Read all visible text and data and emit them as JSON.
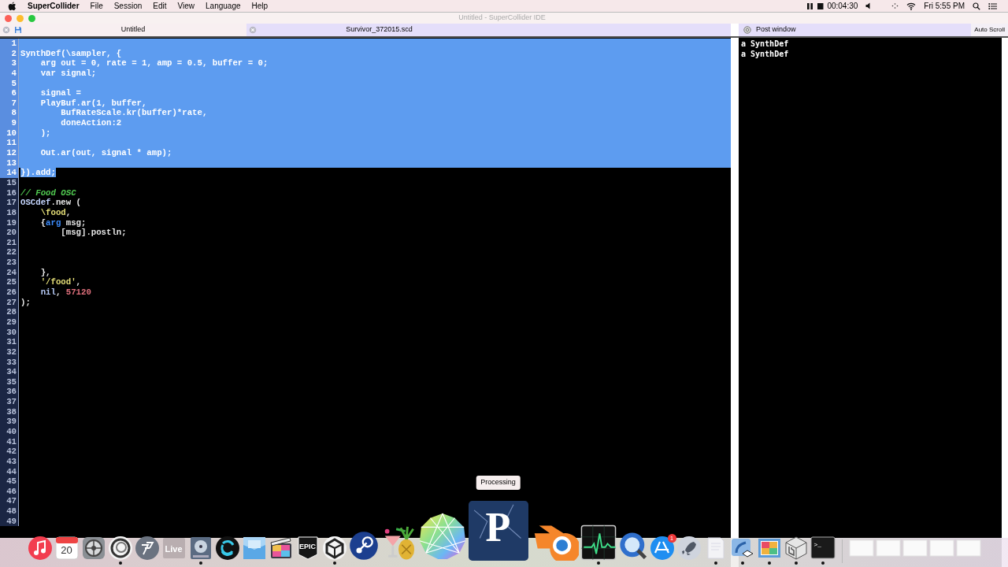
{
  "menu_bar": {
    "app": "SuperCollider",
    "menus": [
      "File",
      "Session",
      "Edit",
      "View",
      "Language",
      "Help"
    ],
    "timer": "00:04:30",
    "clock": "Fri 5:55 PM"
  },
  "window": {
    "title": "Untitled - SuperCollider IDE"
  },
  "tabs": [
    {
      "label": "Untitled",
      "selected": true,
      "unsaved": true
    },
    {
      "label": "Survivor_372015.scd",
      "selected": false,
      "unsaved": false
    }
  ],
  "editor": {
    "lines": [
      {
        "n": "1",
        "selected": true
      },
      {
        "n": "2",
        "selected": true,
        "tokens": [
          {
            "kind": "class",
            "text": "SynthDef"
          },
          {
            "kind": "plain",
            "text": "("
          },
          {
            "kind": "symbol",
            "text": "\\sampler"
          },
          {
            "kind": "plain",
            "text": ", {"
          }
        ]
      },
      {
        "n": "3",
        "selected": true,
        "tokens": [
          {
            "kind": "keyword",
            "text": "    arg"
          },
          {
            "kind": "plain",
            "text": " out = "
          },
          {
            "kind": "number",
            "text": "0"
          },
          {
            "kind": "plain",
            "text": ", rate = "
          },
          {
            "kind": "number",
            "text": "1"
          },
          {
            "kind": "plain",
            "text": ", amp = "
          },
          {
            "kind": "number",
            "text": "0.5"
          },
          {
            "kind": "plain",
            "text": ", buffer = "
          },
          {
            "kind": "number",
            "text": "0"
          },
          {
            "kind": "plain",
            "text": ";"
          }
        ]
      },
      {
        "n": "4",
        "selected": true,
        "tokens": [
          {
            "kind": "keyword",
            "text": "    var"
          },
          {
            "kind": "plain",
            "text": " signal;"
          }
        ]
      },
      {
        "n": "5",
        "selected": true
      },
      {
        "n": "6",
        "selected": true,
        "tokens": [
          {
            "kind": "plain",
            "text": "    signal ="
          }
        ]
      },
      {
        "n": "7",
        "selected": true,
        "tokens": [
          {
            "kind": "class",
            "text": "    PlayBuf"
          },
          {
            "kind": "plain",
            "text": ".ar("
          },
          {
            "kind": "number",
            "text": "1"
          },
          {
            "kind": "plain",
            "text": ", buffer,"
          }
        ]
      },
      {
        "n": "8",
        "selected": true,
        "tokens": [
          {
            "kind": "class",
            "text": "        BufRateScale"
          },
          {
            "kind": "plain",
            "text": ".kr(buffer)*rate,"
          }
        ]
      },
      {
        "n": "9",
        "selected": true,
        "tokens": [
          {
            "kind": "plain",
            "text": "        doneAction:"
          },
          {
            "kind": "number",
            "text": "2"
          }
        ]
      },
      {
        "n": "10",
        "selected": true,
        "tokens": [
          {
            "kind": "plain",
            "text": "    );"
          }
        ]
      },
      {
        "n": "11",
        "selected": true
      },
      {
        "n": "12",
        "selected": true,
        "tokens": [
          {
            "kind": "class",
            "text": "    Out"
          },
          {
            "kind": "plain",
            "text": ".ar(out, signal * amp);"
          }
        ]
      },
      {
        "n": "13",
        "selected": true
      },
      {
        "n": "14",
        "selected": true,
        "tokens": [
          {
            "kind": "plain",
            "text": "}).add;"
          }
        ]
      },
      {
        "n": "15",
        "selected": false
      },
      {
        "n": "16",
        "selected": false,
        "tokens": [
          {
            "kind": "comment",
            "text": "// Food OSC"
          }
        ]
      },
      {
        "n": "17",
        "selected": false,
        "tokens": [
          {
            "kind": "class",
            "text": "OSCdef"
          },
          {
            "kind": "plain",
            "text": ".new ("
          }
        ]
      },
      {
        "n": "18",
        "selected": false,
        "tokens": [
          {
            "kind": "symbol",
            "text": "    \\food"
          },
          {
            "kind": "plain",
            "text": ","
          }
        ]
      },
      {
        "n": "19",
        "selected": false,
        "tokens": [
          {
            "kind": "plain",
            "text": "    {"
          },
          {
            "kind": "keyword",
            "text": "arg"
          },
          {
            "kind": "plain",
            "text": " msg;"
          }
        ]
      },
      {
        "n": "20",
        "selected": false,
        "tokens": [
          {
            "kind": "plain",
            "text": "        [msg].postln;"
          }
        ]
      },
      {
        "n": "21",
        "selected": false
      },
      {
        "n": "22",
        "selected": false
      },
      {
        "n": "23",
        "selected": false
      },
      {
        "n": "24",
        "selected": false,
        "tokens": [
          {
            "kind": "plain",
            "text": "    },"
          }
        ]
      },
      {
        "n": "25",
        "selected": false,
        "tokens": [
          {
            "kind": "string",
            "text": "    '/food'"
          },
          {
            "kind": "plain",
            "text": ","
          }
        ]
      },
      {
        "n": "26",
        "selected": false,
        "tokens": [
          {
            "kind": "constant",
            "text": "    nil"
          },
          {
            "kind": "plain",
            "text": ", "
          },
          {
            "kind": "number",
            "text": "57120"
          }
        ]
      },
      {
        "n": "27",
        "selected": false,
        "tokens": [
          {
            "kind": "plain",
            "text": ");"
          }
        ]
      },
      {
        "n": "28",
        "selected": false
      },
      {
        "n": "29",
        "selected": false
      },
      {
        "n": "30",
        "selected": false
      },
      {
        "n": "31",
        "selected": false
      },
      {
        "n": "32",
        "selected": false
      },
      {
        "n": "33",
        "selected": false
      },
      {
        "n": "34",
        "selected": false
      },
      {
        "n": "35",
        "selected": false
      },
      {
        "n": "36",
        "selected": false
      },
      {
        "n": "37",
        "selected": false
      },
      {
        "n": "38",
        "selected": false
      },
      {
        "n": "39",
        "selected": false
      },
      {
        "n": "40",
        "selected": false
      },
      {
        "n": "41",
        "selected": false
      },
      {
        "n": "42",
        "selected": false
      },
      {
        "n": "43",
        "selected": false
      },
      {
        "n": "44",
        "selected": false
      },
      {
        "n": "45",
        "selected": false
      },
      {
        "n": "46",
        "selected": false
      },
      {
        "n": "47",
        "selected": false
      },
      {
        "n": "48",
        "selected": false
      },
      {
        "n": "49",
        "selected": false
      }
    ]
  },
  "post_window": {
    "title": "Post window",
    "auto_scroll": "Auto Scroll",
    "lines": [
      "a SynthDef",
      "a SynthDef"
    ]
  },
  "dock": {
    "items": [
      {
        "kind": "music",
        "running": false,
        "hovered": false
      },
      {
        "kind": "calendar",
        "label": "20",
        "running": false,
        "hovered": false
      },
      {
        "kind": "gears",
        "running": false,
        "hovered": false
      },
      {
        "kind": "spiral",
        "running": true,
        "hovered": false
      },
      {
        "kind": "feather",
        "running": false,
        "hovered": false
      },
      {
        "kind": "live",
        "label": "Live",
        "running": false,
        "hovered": false
      },
      {
        "kind": "disk",
        "running": true,
        "hovered": false
      },
      {
        "kind": "loop",
        "running": false,
        "hovered": false
      },
      {
        "kind": "panel",
        "running": false,
        "hovered": false
      },
      {
        "kind": "film",
        "running": false,
        "hovered": false
      },
      {
        "kind": "epic",
        "label": "EPIC",
        "running": false,
        "hovered": false
      },
      {
        "kind": "unity",
        "running": true,
        "hovered": false
      },
      {
        "kind": "steam",
        "running": false,
        "hovered": false
      },
      {
        "kind": "pineapple",
        "running": false,
        "hovered": false
      },
      {
        "kind": "polygon",
        "running": false,
        "hovered": false
      },
      {
        "kind": "processing",
        "label": "P",
        "tooltip": "Processing",
        "running": false,
        "hovered": true
      },
      {
        "kind": "blender",
        "running": false,
        "hovered": false
      },
      {
        "kind": "activity",
        "running": true,
        "hovered": false
      },
      {
        "kind": "quicktime",
        "running": false,
        "hovered": false
      },
      {
        "kind": "appstore",
        "badge": "1",
        "running": false,
        "hovered": false
      },
      {
        "kind": "rocket",
        "running": false,
        "hovered": false
      },
      {
        "kind": "paper",
        "running": true,
        "hovered": false
      },
      {
        "kind": "photo",
        "running": true,
        "hovered": false
      },
      {
        "kind": "preview",
        "running": true,
        "hovered": false
      },
      {
        "kind": "cube",
        "running": true,
        "hovered": false
      },
      {
        "kind": "terminal",
        "label": ">_",
        "running": true,
        "hovered": false
      },
      {
        "kind": "separator"
      },
      {
        "kind": "window",
        "running": false,
        "hovered": false
      },
      {
        "kind": "window",
        "running": false,
        "hovered": false
      },
      {
        "kind": "window",
        "running": false,
        "hovered": false
      },
      {
        "kind": "window",
        "running": false,
        "hovered": false
      },
      {
        "kind": "window",
        "running": false,
        "hovered": false
      }
    ]
  }
}
